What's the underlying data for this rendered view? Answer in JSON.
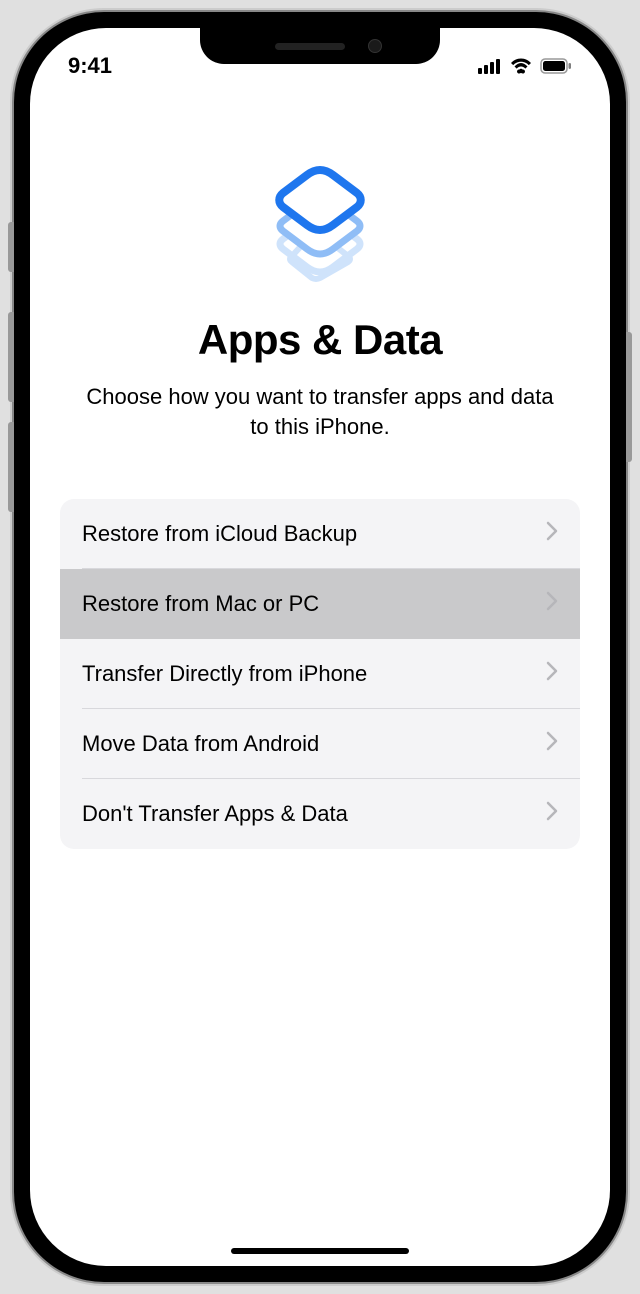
{
  "status_bar": {
    "time": "9:41"
  },
  "header": {
    "title": "Apps & Data",
    "subtitle": "Choose how you want to transfer apps and data to this iPhone."
  },
  "options": [
    {
      "label": "Restore from iCloud Backup",
      "highlighted": false
    },
    {
      "label": "Restore from Mac or PC",
      "highlighted": true
    },
    {
      "label": "Transfer Directly from iPhone",
      "highlighted": false
    },
    {
      "label": "Move Data from Android",
      "highlighted": false
    },
    {
      "label": "Don't Transfer Apps & Data",
      "highlighted": false
    }
  ]
}
